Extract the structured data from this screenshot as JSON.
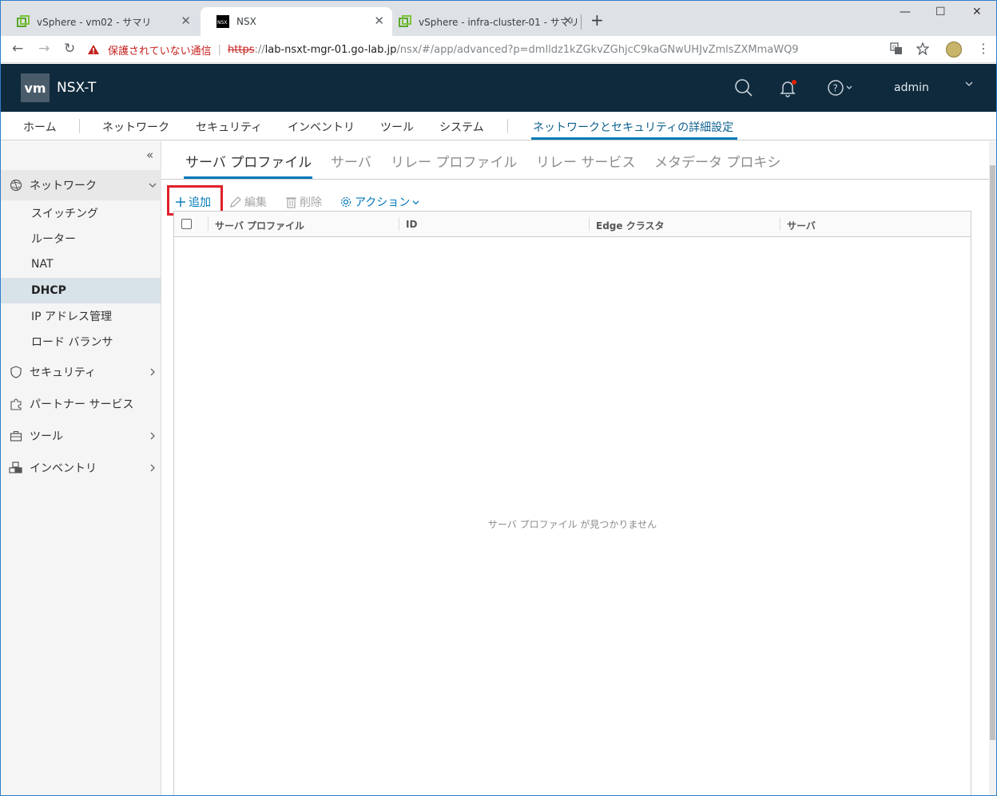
{
  "browser": {
    "tabs": [
      {
        "title": "vSphere - vm02 - サマリ",
        "close": "✕"
      },
      {
        "title": "NSX",
        "close": "✕"
      },
      {
        "title": "vSphere - infra-cluster-01 - サマリ",
        "close": "✕"
      }
    ],
    "new_tab": "+",
    "window_controls": {
      "minimize": "—",
      "maximize": "☐",
      "close": "✕"
    },
    "nav": {
      "back": "←",
      "forward": "→",
      "reload": "↻"
    },
    "security_warning": "保護されていない通信",
    "url": {
      "scheme": "https",
      "rest": "://",
      "host": "lab-nsxt-mgr-01.go-lab.jp",
      "path": "/nsx/#/app/advanced?p=dmlldz1kZGkvZGhjcC9kaGNwUHJvZmlsZXMmaWQ9"
    },
    "menu": "⋮"
  },
  "app": {
    "logo": "vm",
    "product": "NSX-T",
    "user": "admin",
    "colors": {
      "header_bg": "#0f2a3d",
      "accent": "#0079b8",
      "highlight": "#e0202a"
    }
  },
  "topnav": {
    "items": [
      "ホーム",
      "ネットワーク",
      "セキュリティ",
      "インベントリ",
      "ツール",
      "システム",
      "ネットワークとセキュリティの詳細設定"
    ],
    "active_index": 6
  },
  "sidebar": {
    "collapse": "«",
    "groups": [
      {
        "label": "ネットワーク",
        "icon": "network-icon",
        "expanded": true,
        "items": [
          "スイッチング",
          "ルーター",
          "NAT",
          "DHCP",
          "IP アドレス管理",
          "ロード バランサ"
        ],
        "active_item": "DHCP"
      },
      {
        "label": "セキュリティ",
        "icon": "shield-icon"
      },
      {
        "label": "パートナー サービス",
        "icon": "puzzle-icon"
      },
      {
        "label": "ツール",
        "icon": "toolbox-icon"
      },
      {
        "label": "インベントリ",
        "icon": "cubes-icon"
      }
    ]
  },
  "main": {
    "tabs": [
      "サーバ プロファイル",
      "サーバ",
      "リレー プロファイル",
      "リレー サービス",
      "メタデータ プロキシ"
    ],
    "active_tab": 0,
    "toolbar": {
      "add": "追加",
      "edit": "編集",
      "delete": "削除",
      "actions": "アクション"
    },
    "grid": {
      "columns": [
        "サーバ プロファイル",
        "ID",
        "Edge クラスタ",
        "サーバ"
      ],
      "rows": [],
      "empty_message": "サーバ プロファイル が見つかりません"
    }
  }
}
